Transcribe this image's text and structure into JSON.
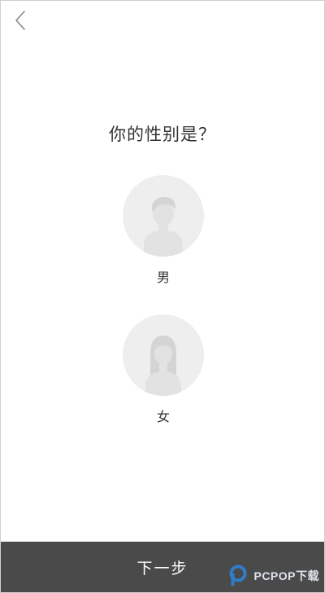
{
  "header": {
    "back_icon": "chevron-left-icon"
  },
  "main": {
    "question": "你的性别是？",
    "options": [
      {
        "label": "男",
        "icon": "male-avatar-icon"
      },
      {
        "label": "女",
        "icon": "female-avatar-icon"
      }
    ]
  },
  "footer": {
    "next_label": "下一步"
  },
  "watermark": {
    "text": "PCPOP下载"
  },
  "colors": {
    "background": "#ffffff",
    "avatar_circle": "#eeeeee",
    "avatar_figure": "#e2e2e2",
    "footer_bar": "#4a4a4a",
    "text": "#333333"
  }
}
